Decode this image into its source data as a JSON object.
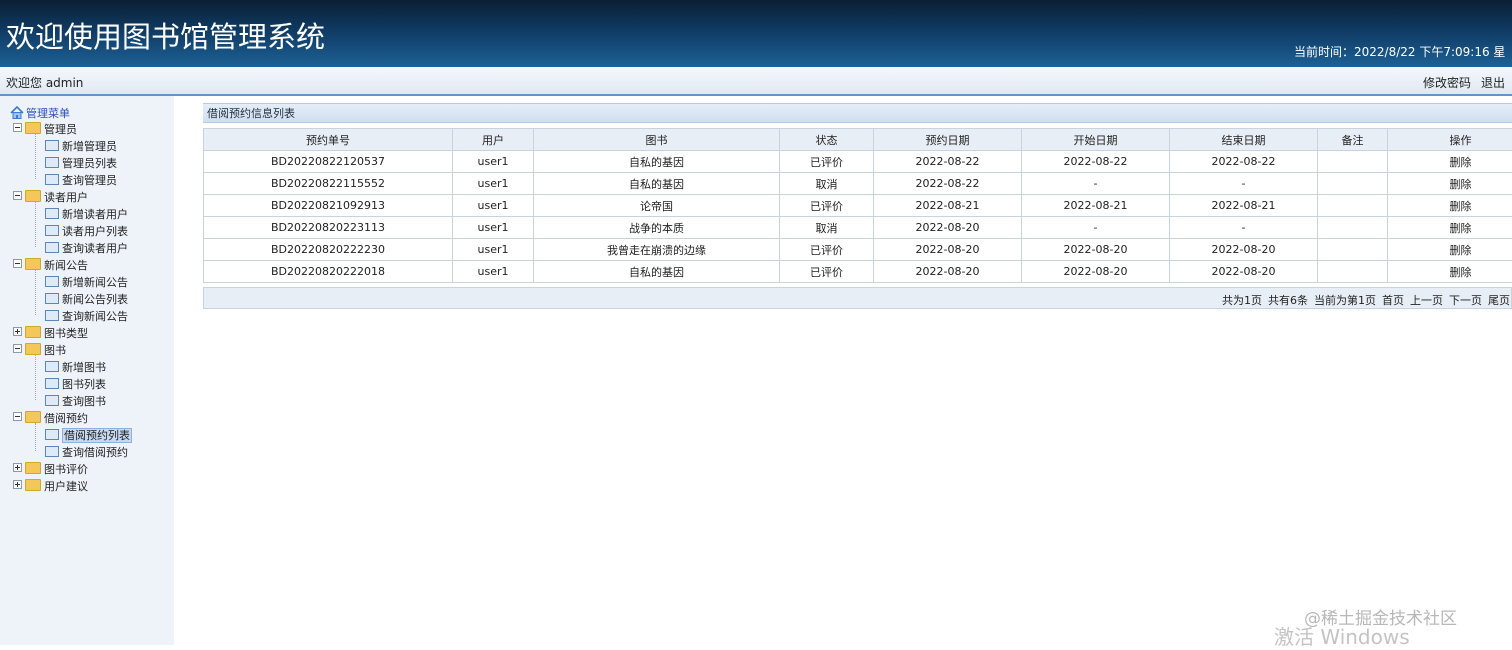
{
  "header": {
    "title": "欢迎使用图书馆管理系统",
    "time_label": "当前时间：",
    "time_value": "2022/8/22 下午7:09:16 星"
  },
  "welcome_bar": {
    "greeting": "欢迎您 admin",
    "change_password": "修改密码",
    "logout": "退出"
  },
  "sidebar": {
    "root": "管理菜单",
    "groups": [
      {
        "label": "管理员",
        "expanded": true,
        "items": [
          "新增管理员",
          "管理员列表",
          "查询管理员"
        ]
      },
      {
        "label": "读者用户",
        "expanded": true,
        "items": [
          "新增读者用户",
          "读者用户列表",
          "查询读者用户"
        ]
      },
      {
        "label": "新闻公告",
        "expanded": true,
        "items": [
          "新增新闻公告",
          "新闻公告列表",
          "查询新闻公告"
        ]
      },
      {
        "label": "图书类型",
        "expanded": false,
        "items": []
      },
      {
        "label": "图书",
        "expanded": true,
        "items": [
          "新增图书",
          "图书列表",
          "查询图书"
        ]
      },
      {
        "label": "借阅预约",
        "expanded": true,
        "items": [
          "借阅预约列表",
          "查询借阅预约"
        ]
      },
      {
        "label": "图书评价",
        "expanded": false,
        "items": []
      },
      {
        "label": "用户建议",
        "expanded": false,
        "items": []
      }
    ],
    "active_item": "借阅预约列表"
  },
  "panel": {
    "title": "借阅预约信息列表"
  },
  "table": {
    "columns": [
      "预约单号",
      "用户",
      "图书",
      "状态",
      "预约日期",
      "开始日期",
      "结束日期",
      "备注",
      "操作"
    ],
    "rows": [
      [
        "BD20220822120537",
        "user1",
        "自私的基因",
        "已评价",
        "2022-08-22",
        "2022-08-22",
        "2022-08-22",
        "",
        "删除"
      ],
      [
        "BD20220822115552",
        "user1",
        "自私的基因",
        "取消",
        "2022-08-22",
        "-",
        "-",
        "",
        "删除"
      ],
      [
        "BD20220821092913",
        "user1",
        "论帝国",
        "已评价",
        "2022-08-21",
        "2022-08-21",
        "2022-08-21",
        "",
        "删除"
      ],
      [
        "BD20220820223113",
        "user1",
        "战争的本质",
        "取消",
        "2022-08-20",
        "-",
        "-",
        "",
        "删除"
      ],
      [
        "BD20220820222230",
        "user1",
        "我曾走在崩溃的边缘",
        "已评价",
        "2022-08-20",
        "2022-08-20",
        "2022-08-20",
        "",
        "删除"
      ],
      [
        "BD20220820222018",
        "user1",
        "自私的基因",
        "已评价",
        "2022-08-20",
        "2022-08-20",
        "2022-08-20",
        "",
        "删除"
      ]
    ]
  },
  "pager": {
    "total_pages": "共为1页",
    "total_records": "共有6条",
    "current_page": "当前为第1页",
    "first": "首页",
    "prev": "上一页",
    "next": "下一页",
    "last": "尾页"
  },
  "watermark": {
    "site": "@稀土掘金技术社区",
    "activate": "激活 Windows"
  }
}
